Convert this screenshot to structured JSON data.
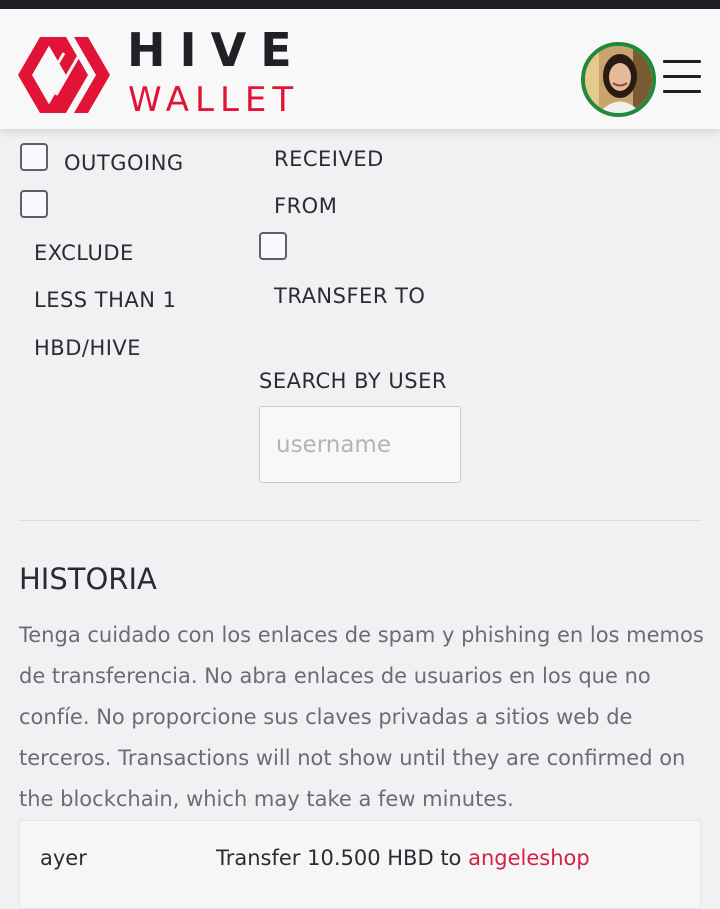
{
  "header": {
    "logo_top": "HIVE",
    "logo_bottom": "WALLET",
    "brand_color": "#e31337",
    "avatar_border_color": "#1f8a3c"
  },
  "filters": {
    "outgoing_label": "OUTGOING",
    "received_from_line1": "RECEIVED",
    "received_from_line2": "FROM",
    "exclude_line1": "EXCLUDE",
    "exclude_line2": "LESS THAN 1",
    "exclude_line3": "HBD/HIVE",
    "transfer_to_label": "TRANSFER TO",
    "outgoing_checked": false,
    "received_from_checked": false,
    "exclude_small_checked": false,
    "transfer_to_checked": false
  },
  "search": {
    "label": "SEARCH BY USER",
    "placeholder": "username",
    "value": ""
  },
  "history": {
    "title": "HISTORIA",
    "warning": "Tenga cuidado con los enlaces de spam y phishing en los memos de transferencia. No abra enlaces de usuarios en los que no confíe. No proporcione sus claves privadas a sitios web de terceros. Transactions will not show until they are confirmed on the blockchain, which may take a few minutes.",
    "rows": [
      {
        "date": "ayer",
        "text": "Transfer 10.500 HBD to",
        "user": "angeleshop"
      }
    ]
  }
}
